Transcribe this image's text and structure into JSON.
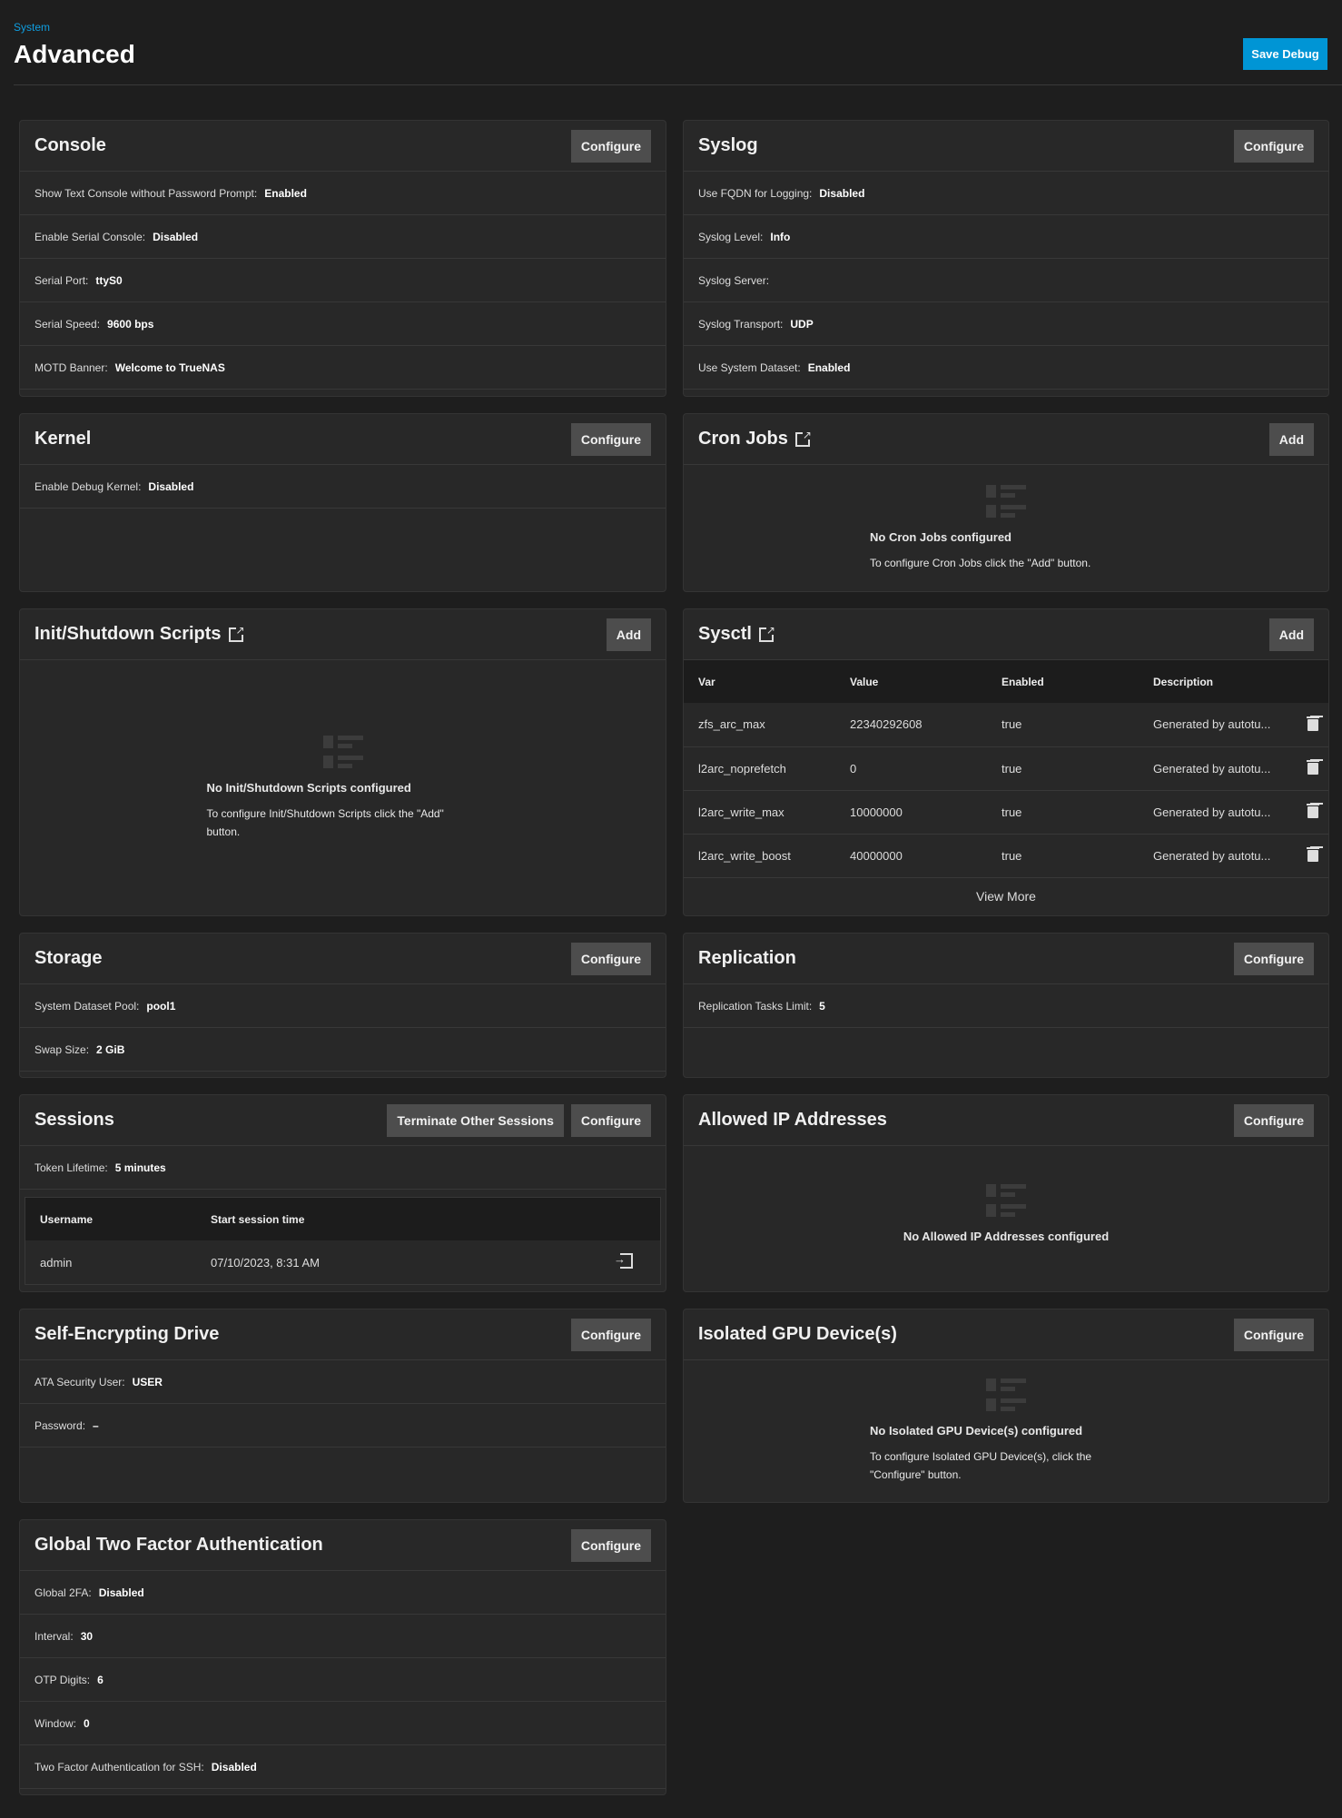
{
  "header": {
    "breadcrumb": "System",
    "title": "Advanced",
    "save_debug": "Save Debug"
  },
  "cards": [
    {
      "id": "console",
      "title": "Console",
      "buttons": [
        "Configure"
      ],
      "rows": [
        {
          "label": "Show Text Console without Password Prompt:",
          "value": "Enabled"
        },
        {
          "label": "Enable Serial Console:",
          "value": "Disabled"
        },
        {
          "label": "Serial Port:",
          "value": "ttyS0"
        },
        {
          "label": "Serial Speed:",
          "value": "9600 bps"
        },
        {
          "label": "MOTD Banner:",
          "value": "Welcome to TrueNAS"
        }
      ]
    },
    {
      "id": "syslog",
      "title": "Syslog",
      "buttons": [
        "Configure"
      ],
      "rows": [
        {
          "label": "Use FQDN for Logging:",
          "value": "Disabled"
        },
        {
          "label": "Syslog Level:",
          "value": "Info"
        },
        {
          "label": "Syslog Server:",
          "value": ""
        },
        {
          "label": "Syslog Transport:",
          "value": "UDP"
        },
        {
          "label": "Use System Dataset:",
          "value": "Enabled"
        }
      ]
    },
    {
      "id": "kernel",
      "title": "Kernel",
      "buttons": [
        "Configure"
      ],
      "rows": [
        {
          "label": "Enable Debug Kernel:",
          "value": "Disabled"
        }
      ]
    },
    {
      "id": "cron-jobs",
      "title": "Cron Jobs",
      "external": true,
      "buttons": [
        "Add"
      ],
      "empty": {
        "title": "No Cron Jobs configured",
        "text": "To configure Cron Jobs click the \"Add\" button."
      }
    },
    {
      "id": "init-shutdown-scripts",
      "title": "Init/Shutdown Scripts",
      "external": true,
      "buttons": [
        "Add"
      ],
      "empty": {
        "title": "No Init/Shutdown Scripts configured",
        "text": "To configure Init/Shutdown Scripts click the \"Add\" button."
      }
    },
    {
      "id": "sysctl",
      "title": "Sysctl",
      "external": true,
      "buttons": [
        "Add"
      ],
      "table": {
        "columns": [
          "Var",
          "Value",
          "Enabled",
          "Description"
        ],
        "rows": [
          [
            "zfs_arc_max",
            "22340292608",
            "true",
            "Generated by autotu..."
          ],
          [
            "l2arc_noprefetch",
            "0",
            "true",
            "Generated by autotu..."
          ],
          [
            "l2arc_write_max",
            "10000000",
            "true",
            "Generated by autotu..."
          ],
          [
            "l2arc_write_boost",
            "40000000",
            "true",
            "Generated by autotu..."
          ]
        ],
        "view_more": "View More"
      }
    },
    {
      "id": "storage",
      "title": "Storage",
      "buttons": [
        "Configure"
      ],
      "rows": [
        {
          "label": "System Dataset Pool:",
          "value": "pool1"
        },
        {
          "label": "Swap Size:",
          "value": "2 GiB"
        }
      ]
    },
    {
      "id": "replication",
      "title": "Replication",
      "buttons": [
        "Configure"
      ],
      "rows": [
        {
          "label": "Replication Tasks Limit:",
          "value": "5"
        }
      ]
    },
    {
      "id": "sessions",
      "title": "Sessions",
      "buttons": [
        "Terminate Other Sessions",
        "Configure"
      ],
      "rows": [
        {
          "label": "Token Lifetime:",
          "value": "5 minutes"
        }
      ],
      "sessions": {
        "columns": [
          "Username",
          "Start session time"
        ],
        "rows": [
          [
            "admin",
            "07/10/2023, 8:31 AM"
          ]
        ]
      }
    },
    {
      "id": "allowed-ip-addresses",
      "title": "Allowed IP Addresses",
      "buttons": [
        "Configure"
      ],
      "empty": {
        "title": "No Allowed IP Addresses configured",
        "text": ""
      }
    },
    {
      "id": "self-encrypting-drive",
      "title": "Self-Encrypting Drive",
      "buttons": [
        "Configure"
      ],
      "rows": [
        {
          "label": "ATA Security User:",
          "value": "USER"
        },
        {
          "label": "Password:",
          "value": "–"
        }
      ]
    },
    {
      "id": "isolated-gpu-devices",
      "title": "Isolated GPU Device(s)",
      "buttons": [
        "Configure"
      ],
      "empty": {
        "title": "No Isolated GPU Device(s) configured",
        "text": "To configure Isolated GPU Device(s), click the \"Configure\" button."
      }
    },
    {
      "id": "global-two-factor-authentication",
      "title": "Global Two Factor Authentication",
      "buttons": [
        "Configure"
      ],
      "rows": [
        {
          "label": "Global 2FA:",
          "value": "Disabled"
        },
        {
          "label": "Interval:",
          "value": "30"
        },
        {
          "label": "OTP Digits:",
          "value": "6"
        },
        {
          "label": "Window:",
          "value": "0"
        },
        {
          "label": "Two Factor Authentication for SSH:",
          "value": "Disabled"
        }
      ]
    }
  ]
}
